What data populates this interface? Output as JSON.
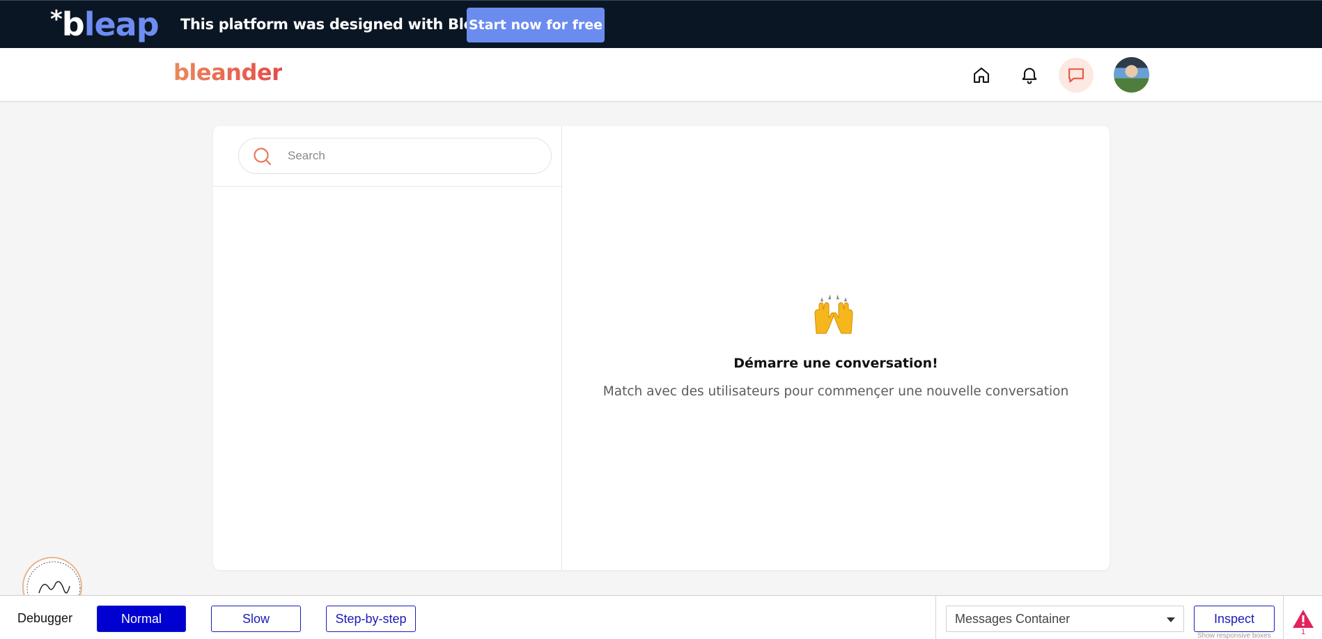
{
  "promo": {
    "logo_star": "*",
    "logo_b": "b",
    "logo_rest": "leap",
    "text": "This platform was designed with Bleap.",
    "cta_label": "Start now for free",
    "bg_color": "#0b1624",
    "cta_color": "#6b8cef"
  },
  "header": {
    "brand": "bleander",
    "brand_gradient": [
      "#e9895c",
      "#e64b4b"
    ],
    "icons": [
      "home-icon",
      "bell-icon",
      "chat-icon"
    ],
    "active_icon": "chat-icon"
  },
  "search": {
    "placeholder": "Search",
    "value": ""
  },
  "empty_state": {
    "emoji": "🙌",
    "title": "Démarre une conversation!",
    "subtitle": "Match avec des utilisateurs pour commençer une nouvelle conversation"
  },
  "debugger": {
    "label": "Debugger",
    "modes": [
      "Normal",
      "Slow",
      "Step-by-step"
    ],
    "active_mode": "Normal",
    "selected_element": "Messages Container",
    "inspect_label": "Inspect",
    "hint": "Show responsive boxes",
    "warning_count": "1",
    "accent_color": "#0000d0",
    "warning_color": "#e0245e"
  }
}
